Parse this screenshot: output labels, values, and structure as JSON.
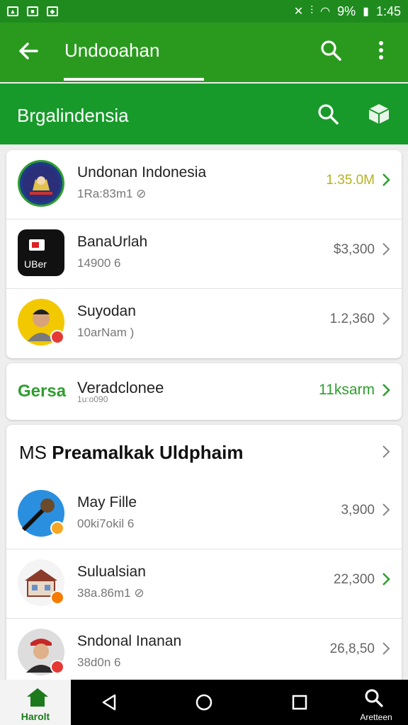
{
  "status_bar": {
    "battery": "9%",
    "time": "1:45"
  },
  "appbar": {
    "title": "Undooahan"
  },
  "subbar": {
    "title": "Brgalindensia"
  },
  "list_top": [
    {
      "title": "Undonan Indonesia",
      "subtitle": "1Ra:83m1 ⊘",
      "value": "1.35.0M",
      "value_color": "#b7b21e"
    },
    {
      "title": "BanaUrlah",
      "subtitle": "14900 6",
      "value": "$3,300",
      "value_color": "#666666"
    },
    {
      "title": "Suyodan",
      "subtitle": "10arNam )",
      "value": "1.2,360",
      "value_color": "#666666"
    }
  ],
  "promo": {
    "brand": "Gersa",
    "title": "Veradclonee",
    "subtitle": "1u:o090",
    "value": "11ksarm"
  },
  "section": {
    "prefix": "MS",
    "title": "Preamalkak Uldphaim"
  },
  "list_bottom": [
    {
      "title": "May Fille",
      "subtitle": "00ki7okil 6",
      "value": "3,900",
      "value_color": "#666666"
    },
    {
      "title": "Sulualsian",
      "subtitle": "38a.86m1 ⊘",
      "value": "22,300",
      "value_color": "#666666"
    },
    {
      "title": "Sndonal Inanan",
      "subtitle": "38d0n 6",
      "value": "26,8,50",
      "value_color": "#666666"
    }
  ],
  "avatar_labels": {
    "uber": "UBer"
  },
  "bottom_nav": {
    "home_label": "Harolt",
    "search_label": "Aretteen"
  },
  "colors": {
    "status": "#1f8b1f",
    "appbar": "#2a9a1e",
    "subbar": "#179a2a",
    "accent_green": "#2e9e2e"
  }
}
